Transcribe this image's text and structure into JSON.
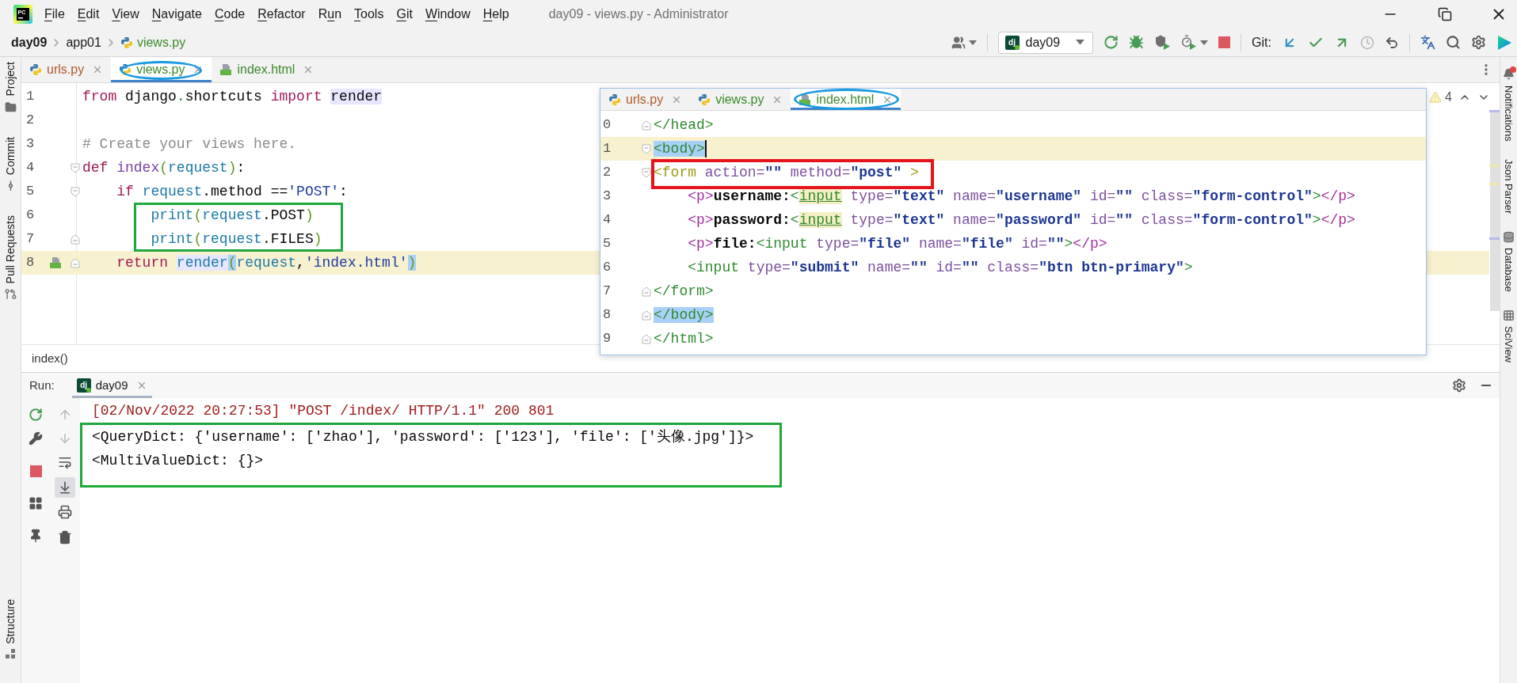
{
  "window": {
    "logo": "PC",
    "title": "day09 - views.py - Administrator"
  },
  "menu": [
    {
      "key": "F",
      "rest": "ile"
    },
    {
      "key": "E",
      "rest": "dit"
    },
    {
      "key": "V",
      "rest": "iew"
    },
    {
      "key": "N",
      "rest": "avigate"
    },
    {
      "key": "C",
      "rest": "ode"
    },
    {
      "key": "R",
      "rest": "efactor"
    },
    {
      "lead": "R",
      "key": "u",
      "rest": "n"
    },
    {
      "key": "T",
      "rest": "ools"
    },
    {
      "key": "G",
      "rest": "it"
    },
    {
      "key": "W",
      "rest": "indow"
    },
    {
      "key": "H",
      "rest": "elp"
    }
  ],
  "breadcrumbs": [
    {
      "label": "day09",
      "kind": "project"
    },
    {
      "label": "app01",
      "kind": "folder"
    },
    {
      "label": "views.py",
      "kind": "python",
      "color": "#3a8a2c"
    }
  ],
  "toolbar": {
    "config_icon": "dj",
    "run_config": "day09",
    "git_label": "Git:"
  },
  "left_stripe": {
    "top": [
      {
        "label": "Project",
        "kind": "project"
      },
      {
        "label": "Commit",
        "kind": "commit"
      },
      {
        "label": "Pull Requests",
        "kind": "pull_requests"
      }
    ],
    "bottom": [
      {
        "label": "Structure",
        "kind": "structure"
      }
    ]
  },
  "right_stripe": [
    {
      "label": "Notifications",
      "kind": "notifications",
      "alert": true
    },
    {
      "label": "Json Parser",
      "alert": false
    },
    {
      "label": "Database",
      "kind": "database",
      "alert": false
    },
    {
      "label": "SciView",
      "kind": "sciview",
      "alert": false
    }
  ],
  "editor_tabs": [
    {
      "label": "urls.py",
      "kind": "python",
      "color": "#b0582a",
      "selected": false,
      "circled": false
    },
    {
      "label": "views.py",
      "kind": "python",
      "color": "#3a8a2c",
      "selected": true,
      "circled": true
    },
    {
      "label": "index.html",
      "kind": "html",
      "color": "#3a8a2c",
      "selected": false,
      "circled": false
    }
  ],
  "editor": {
    "warnings": "4",
    "lines": [
      {
        "number": "1",
        "kind": "plain",
        "current": false,
        "boxed": false,
        "tokens": [
          {
            "text": "from",
            "kind": "kw"
          },
          {
            "text": " django",
            "kind": "plain"
          },
          {
            "text": ".",
            "kind": "dot"
          },
          {
            "text": "shortcuts ",
            "kind": "plain"
          },
          {
            "text": "import ",
            "kind": "kw"
          },
          {
            "text": "render",
            "kind": "plain_usage"
          }
        ]
      },
      {
        "number": "2",
        "kind": "plain",
        "current": false,
        "boxed": false
      },
      {
        "number": "3",
        "kind": "plain",
        "current": false,
        "boxed": false,
        "tokens": [
          {
            "text": "# Create your views here.",
            "kind": "comment"
          }
        ]
      },
      {
        "number": "4",
        "kind": "fold_start",
        "current": false,
        "boxed": false,
        "tokens": [
          {
            "text": "def ",
            "kind": "kw"
          },
          {
            "text": "index",
            "kind": "func"
          },
          {
            "text": "(",
            "kind": "paren"
          },
          {
            "text": "request",
            "kind": "name"
          },
          {
            "text": ")",
            "kind": "paren"
          },
          {
            "text": ":",
            "kind": "plain"
          }
        ]
      },
      {
        "number": "5",
        "kind": "fold_start",
        "current": false,
        "boxed": false,
        "tokens": [
          {
            "text": "    if ",
            "kind": "kw"
          },
          {
            "text": "request",
            "kind": "name"
          },
          {
            "text": ".method ==",
            "kind": "plain"
          },
          {
            "text": "'POST'",
            "kind": "string"
          },
          {
            "text": ":",
            "kind": "plain"
          }
        ]
      },
      {
        "number": "6",
        "kind": "plain",
        "current": false,
        "boxed": true,
        "tokens": [
          {
            "text": "        print",
            "kind": "name"
          },
          {
            "text": "(",
            "kind": "paren"
          },
          {
            "text": "request",
            "kind": "name"
          },
          {
            "text": ".POST",
            "kind": "plain"
          },
          {
            "text": ")",
            "kind": "paren"
          }
        ]
      },
      {
        "number": "7",
        "kind": "fold_end",
        "current": false,
        "boxed": true,
        "tokens": [
          {
            "text": "        print",
            "kind": "name"
          },
          {
            "text": "(",
            "kind": "paren"
          },
          {
            "text": "request",
            "kind": "name"
          },
          {
            "text": ".FILES",
            "kind": "plain"
          },
          {
            "text": ")",
            "kind": "paren"
          }
        ]
      },
      {
        "number": "8",
        "kind": "fold_end_template",
        "current": true,
        "boxed": false,
        "tokens": [
          {
            "text": "    return ",
            "kind": "kw"
          },
          {
            "text": "render",
            "kind": "name_usage"
          },
          {
            "text": "(",
            "kind": "paren_match"
          },
          {
            "text": "request",
            "kind": "name"
          },
          {
            "text": ",",
            "kind": "plain"
          },
          {
            "text": "'index.html'",
            "kind": "string"
          },
          {
            "text": ")",
            "kind": "paren_match"
          }
        ]
      }
    ]
  },
  "editor_crumb": "index()",
  "popup": {
    "tabs": [
      {
        "label": "urls.py",
        "kind": "python",
        "color": "#b0582a",
        "selected": false,
        "circled": false
      },
      {
        "label": "views.py",
        "kind": "python",
        "color": "#3a8a2c",
        "selected": false,
        "circled": false
      },
      {
        "label": "index.html",
        "kind": "html",
        "color": "#3a8a2c",
        "selected": true,
        "circled": true
      }
    ],
    "lines": [
      {
        "number": "0",
        "kind": "fold_end",
        "current": false,
        "caret": false,
        "boxed": false,
        "tokens": [
          {
            "text": "</head>",
            "kind": "tag"
          }
        ]
      },
      {
        "number": "1",
        "kind": "fold_start",
        "current": true,
        "caret": true,
        "boxed": false,
        "tokens": [
          {
            "text": "<body>",
            "kind": "tag_match"
          }
        ]
      },
      {
        "number": "2",
        "kind": "fold_start",
        "current": false,
        "caret": false,
        "boxed": true,
        "tokens": [
          {
            "text": "<form",
            "kind": "formtag"
          },
          {
            "text": " action=",
            "kind": "attr"
          },
          {
            "text": "\"\"",
            "kind": "value"
          },
          {
            "text": " method=",
            "kind": "attr"
          },
          {
            "text": "\"post\"",
            "kind": "value"
          },
          {
            "text": " >",
            "kind": "formtag"
          }
        ]
      },
      {
        "number": "3",
        "kind": "plain",
        "current": false,
        "caret": false,
        "boxed": false,
        "tokens": [
          {
            "text": "    <p>",
            "kind": "ptag"
          },
          {
            "text": "username:",
            "kind": "bold"
          },
          {
            "text": "<",
            "kind": "tag"
          },
          {
            "text": "input",
            "kind": "tag_warn"
          },
          {
            "text": " type=",
            "kind": "attr"
          },
          {
            "text": "\"text\"",
            "kind": "value"
          },
          {
            "text": " name=",
            "kind": "attr"
          },
          {
            "text": "\"username\"",
            "kind": "value"
          },
          {
            "text": " id=",
            "kind": "attr"
          },
          {
            "text": "\"\"",
            "kind": "value"
          },
          {
            "text": " class=",
            "kind": "attr"
          },
          {
            "text": "\"form-control\"",
            "kind": "value"
          },
          {
            "text": ">",
            "kind": "tag"
          },
          {
            "text": "</p>",
            "kind": "ptag"
          }
        ]
      },
      {
        "number": "4",
        "kind": "plain",
        "current": false,
        "caret": false,
        "boxed": false,
        "tokens": [
          {
            "text": "    <p>",
            "kind": "ptag"
          },
          {
            "text": "password:",
            "kind": "bold"
          },
          {
            "text": "<",
            "kind": "tag"
          },
          {
            "text": "input",
            "kind": "tag_warn"
          },
          {
            "text": " type=",
            "kind": "attr"
          },
          {
            "text": "\"text\"",
            "kind": "value"
          },
          {
            "text": " name=",
            "kind": "attr"
          },
          {
            "text": "\"password\"",
            "kind": "value"
          },
          {
            "text": " id=",
            "kind": "attr"
          },
          {
            "text": "\"\"",
            "kind": "value"
          },
          {
            "text": " class=",
            "kind": "attr"
          },
          {
            "text": "\"form-control\"",
            "kind": "value"
          },
          {
            "text": ">",
            "kind": "tag"
          },
          {
            "text": "</p>",
            "kind": "ptag"
          }
        ]
      },
      {
        "number": "5",
        "kind": "plain",
        "current": false,
        "caret": false,
        "boxed": false,
        "tokens": [
          {
            "text": "    <p>",
            "kind": "ptag"
          },
          {
            "text": "file:",
            "kind": "bold"
          },
          {
            "text": "<input",
            "kind": "tag"
          },
          {
            "text": " type=",
            "kind": "attr"
          },
          {
            "text": "\"file\"",
            "kind": "value"
          },
          {
            "text": " name=",
            "kind": "attr"
          },
          {
            "text": "\"file\"",
            "kind": "value"
          },
          {
            "text": " id=",
            "kind": "attr"
          },
          {
            "text": "\"\"",
            "kind": "value"
          },
          {
            "text": ">",
            "kind": "tag"
          },
          {
            "text": "</p>",
            "kind": "ptag"
          }
        ]
      },
      {
        "number": "6",
        "kind": "plain",
        "current": false,
        "caret": false,
        "boxed": false,
        "tokens": [
          {
            "text": "    <input",
            "kind": "tag"
          },
          {
            "text": " type=",
            "kind": "attr"
          },
          {
            "text": "\"submit\"",
            "kind": "value"
          },
          {
            "text": " name=",
            "kind": "attr"
          },
          {
            "text": "\"\"",
            "kind": "value"
          },
          {
            "text": " id=",
            "kind": "attr"
          },
          {
            "text": "\"\"",
            "kind": "value"
          },
          {
            "text": " class=",
            "kind": "attr"
          },
          {
            "text": "\"btn btn-primary\"",
            "kind": "value"
          },
          {
            "text": ">",
            "kind": "tag"
          }
        ]
      },
      {
        "number": "7",
        "kind": "fold_end",
        "current": false,
        "caret": false,
        "boxed": false,
        "tokens": [
          {
            "text": "</form>",
            "kind": "tag"
          }
        ]
      },
      {
        "number": "8",
        "kind": "fold_end",
        "current": false,
        "caret": false,
        "boxed": false,
        "tokens": [
          {
            "text": "</body>",
            "kind": "tag_match"
          }
        ]
      },
      {
        "number": "9",
        "kind": "fold_end",
        "current": false,
        "caret": false,
        "boxed": false,
        "tokens": [
          {
            "text": "</html>",
            "kind": "tag"
          }
        ]
      }
    ]
  },
  "run": {
    "label": "Run:",
    "tab": {
      "icon": "dj",
      "label": "day09",
      "selected": true
    },
    "soft_wrap": false,
    "scroll_to_end": true,
    "lines": [
      {
        "text": "[02/Nov/2022 20:27:53] \"POST /index/ HTTP/1.1\" 200 801",
        "kind": "log",
        "boxed": false
      },
      {
        "text": "<QueryDict: {'username': ['zhao'], 'password': ['123'], 'file': ['头像.jpg']}>",
        "kind": "output",
        "boxed": true
      },
      {
        "text": "<MultiValueDict: {}>",
        "kind": "output",
        "boxed": true
      }
    ]
  }
}
